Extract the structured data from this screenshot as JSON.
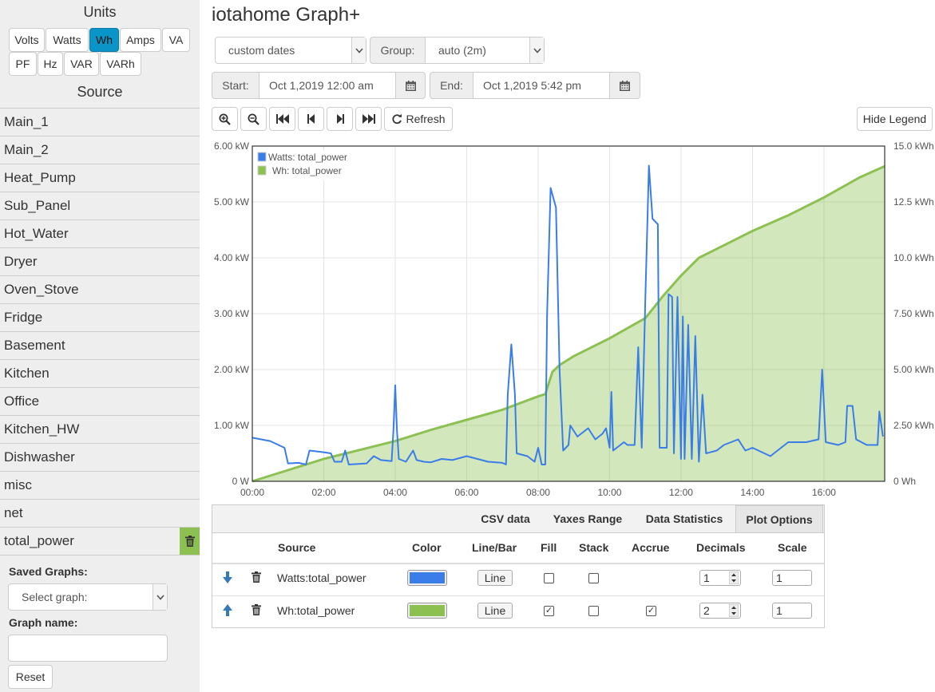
{
  "sidebar": {
    "units_title": "Units",
    "units": [
      "Volts",
      "Watts",
      "Wh",
      "Amps",
      "VA",
      "PF",
      "Hz",
      "VAR",
      "VARh"
    ],
    "source_title": "Source",
    "sources": [
      "Main_1",
      "Main_2",
      "Heat_Pump",
      "Sub_Panel",
      "Hot_Water",
      "Dryer",
      "Oven_Stove",
      "Fridge",
      "Basement",
      "Kitchen",
      "Office",
      "Kitchen_HW",
      "Dishwasher",
      "misc",
      "net",
      "total_power"
    ],
    "saved_graphs_label": "Saved Graphs:",
    "saved_graphs_placeholder": "Select graph:",
    "graph_name_label": "Graph name:",
    "graph_name_value": "",
    "reset_label": "Reset"
  },
  "header": {
    "title": "iotahome Graph+"
  },
  "controls": {
    "range_select": "custom dates",
    "group_label": "Group:",
    "group_value": "auto (2m)",
    "start_label": "Start:",
    "start_value": "Oct 1,2019 12:00 am",
    "end_label": "End:",
    "end_value": "Oct 1,2019 5:42 pm",
    "refresh_label": "Refresh",
    "hide_legend_label": "Hide Legend"
  },
  "chart_data": {
    "type": "line",
    "x_ticks": [
      "00:00",
      "02:00",
      "04:00",
      "06:00",
      "08:00",
      "10:00",
      "12:00",
      "14:00",
      "16:00"
    ],
    "y_left_ticks": [
      "0 W",
      "1.00 kW",
      "2.00 kW",
      "3.00 kW",
      "4.00 kW",
      "5.00 kW",
      "6.00 kW"
    ],
    "y_right_ticks": [
      "0 Wh",
      "2.50 kWh",
      "5.00 kWh",
      "7.50 kWh",
      "10.0 kWh",
      "12.5 kWh",
      "15.0 kWh"
    ],
    "x_range_hours": [
      0,
      17.7
    ],
    "y_left_range_kw": [
      0,
      6
    ],
    "y_right_range_kwh": [
      0,
      15
    ],
    "legend": [
      "Watts: total_power",
      "Wh: total_power"
    ],
    "legend_position": "top-left",
    "grid": true,
    "series": [
      {
        "name": "Watts: total_power",
        "axis": "left",
        "color": "#3a7de8",
        "fill": false,
        "points": [
          [
            0,
            0.78
          ],
          [
            0.5,
            0.72
          ],
          [
            0.9,
            0.6
          ],
          [
            1.0,
            0.32
          ],
          [
            1.3,
            0.33
          ],
          [
            1.5,
            0.3
          ],
          [
            1.6,
            0.55
          ],
          [
            2.0,
            0.52
          ],
          [
            2.2,
            0.5
          ],
          [
            2.3,
            0.35
          ],
          [
            2.5,
            0.35
          ],
          [
            2.6,
            0.55
          ],
          [
            2.7,
            0.3
          ],
          [
            3.2,
            0.32
          ],
          [
            3.4,
            0.45
          ],
          [
            3.6,
            0.38
          ],
          [
            3.9,
            0.36
          ],
          [
            3.95,
            0.9
          ],
          [
            4.0,
            1.72
          ],
          [
            4.05,
            0.9
          ],
          [
            4.1,
            0.4
          ],
          [
            4.3,
            0.35
          ],
          [
            4.5,
            0.55
          ],
          [
            4.6,
            0.38
          ],
          [
            4.8,
            0.35
          ],
          [
            5.0,
            0.34
          ],
          [
            5.3,
            0.4
          ],
          [
            5.6,
            0.38
          ],
          [
            6.0,
            0.45
          ],
          [
            6.3,
            0.4
          ],
          [
            6.6,
            0.35
          ],
          [
            7.0,
            0.33
          ],
          [
            7.1,
            0.3
          ],
          [
            7.15,
            1.55
          ],
          [
            7.25,
            2.45
          ],
          [
            7.35,
            1.55
          ],
          [
            7.4,
            0.5
          ],
          [
            7.7,
            0.45
          ],
          [
            7.9,
            0.35
          ],
          [
            8.0,
            0.6
          ],
          [
            8.1,
            0.3
          ],
          [
            8.2,
            0.3
          ],
          [
            8.25,
            3.0
          ],
          [
            8.35,
            5.25
          ],
          [
            8.5,
            4.9
          ],
          [
            8.6,
            2.0
          ],
          [
            8.7,
            0.55
          ],
          [
            8.85,
            0.65
          ],
          [
            8.9,
            1.0
          ],
          [
            9.1,
            0.8
          ],
          [
            9.4,
            0.95
          ],
          [
            9.6,
            0.75
          ],
          [
            9.8,
            0.85
          ],
          [
            9.9,
            0.95
          ],
          [
            10.0,
            0.6
          ],
          [
            10.05,
            1.6
          ],
          [
            10.1,
            0.55
          ],
          [
            10.4,
            0.7
          ],
          [
            10.5,
            0.65
          ],
          [
            10.7,
            0.65
          ],
          [
            10.8,
            2.4
          ],
          [
            10.9,
            0.6
          ],
          [
            11.0,
            3.25
          ],
          [
            11.1,
            5.65
          ],
          [
            11.2,
            4.7
          ],
          [
            11.35,
            4.6
          ],
          [
            11.4,
            0.6
          ],
          [
            11.6,
            0.6
          ],
          [
            11.65,
            3.35
          ],
          [
            11.75,
            3.3
          ],
          [
            11.8,
            0.5
          ],
          [
            11.9,
            3.3
          ],
          [
            12.0,
            0.4
          ],
          [
            12.05,
            2.95
          ],
          [
            12.1,
            0.4
          ],
          [
            12.2,
            2.8
          ],
          [
            12.3,
            0.4
          ],
          [
            12.4,
            2.6
          ],
          [
            12.5,
            0.35
          ],
          [
            12.6,
            1.55
          ],
          [
            12.7,
            0.5
          ],
          [
            13.0,
            0.55
          ],
          [
            13.2,
            0.65
          ],
          [
            13.4,
            0.7
          ],
          [
            13.6,
            0.75
          ],
          [
            13.8,
            0.55
          ],
          [
            14.0,
            0.6
          ],
          [
            14.5,
            0.45
          ],
          [
            15.0,
            0.7
          ],
          [
            15.5,
            0.7
          ],
          [
            15.85,
            0.75
          ],
          [
            15.95,
            2.0
          ],
          [
            16.05,
            0.7
          ],
          [
            16.4,
            0.65
          ],
          [
            16.6,
            0.7
          ],
          [
            16.65,
            1.35
          ],
          [
            16.8,
            1.35
          ],
          [
            16.9,
            0.75
          ],
          [
            17.2,
            0.65
          ],
          [
            17.5,
            0.65
          ],
          [
            17.55,
            1.25
          ],
          [
            17.65,
            0.8
          ]
        ]
      },
      {
        "name": "Wh: total_power",
        "axis": "right",
        "color": "#8cc152",
        "fill": true,
        "points": [
          [
            0,
            0.0
          ],
          [
            1.0,
            0.5
          ],
          [
            2.0,
            1.0
          ],
          [
            3.0,
            1.4
          ],
          [
            4.0,
            1.8
          ],
          [
            5.0,
            2.3
          ],
          [
            6.0,
            2.75
          ],
          [
            7.0,
            3.2
          ],
          [
            8.0,
            3.8
          ],
          [
            8.2,
            3.9
          ],
          [
            8.4,
            4.9
          ],
          [
            8.6,
            5.2
          ],
          [
            9.0,
            5.6
          ],
          [
            10.0,
            6.4
          ],
          [
            11.0,
            7.3
          ],
          [
            11.2,
            7.7
          ],
          [
            11.5,
            8.3
          ],
          [
            12.0,
            9.2
          ],
          [
            12.5,
            10.0
          ],
          [
            13.0,
            10.4
          ],
          [
            14.0,
            11.2
          ],
          [
            15.0,
            11.9
          ],
          [
            16.0,
            12.7
          ],
          [
            17.0,
            13.6
          ],
          [
            17.7,
            14.1
          ]
        ]
      }
    ]
  },
  "tabs": [
    "CSV data",
    "Yaxes Range",
    "Data Statistics",
    "Plot Options"
  ],
  "active_tab": "Plot Options",
  "plot_table": {
    "headers": [
      "Source",
      "Color",
      "Line/Bar",
      "Fill",
      "Stack",
      "Accrue",
      "Decimals",
      "Scale"
    ],
    "rows": [
      {
        "source": "Watts:total_power",
        "color": "#3a7de8",
        "type": "Line",
        "fill": false,
        "stack": false,
        "accrue": null,
        "decimals": "1",
        "scale": "1"
      },
      {
        "source": "Wh:total_power",
        "color": "#8cc152",
        "type": "Line",
        "fill": true,
        "stack": false,
        "accrue": true,
        "decimals": "2",
        "scale": "1"
      }
    ]
  },
  "icons": {
    "zoom_in": "zoom-in-icon",
    "zoom_out": "zoom-out-icon",
    "first": "fast-backward-icon",
    "prev": "step-backward-icon",
    "next": "step-forward-icon",
    "last": "fast-forward-icon",
    "refresh": "refresh-icon",
    "calendar": "calendar-icon",
    "trash": "trash-icon",
    "move_down": "arrow-down-icon",
    "move_up": "arrow-up-icon"
  }
}
